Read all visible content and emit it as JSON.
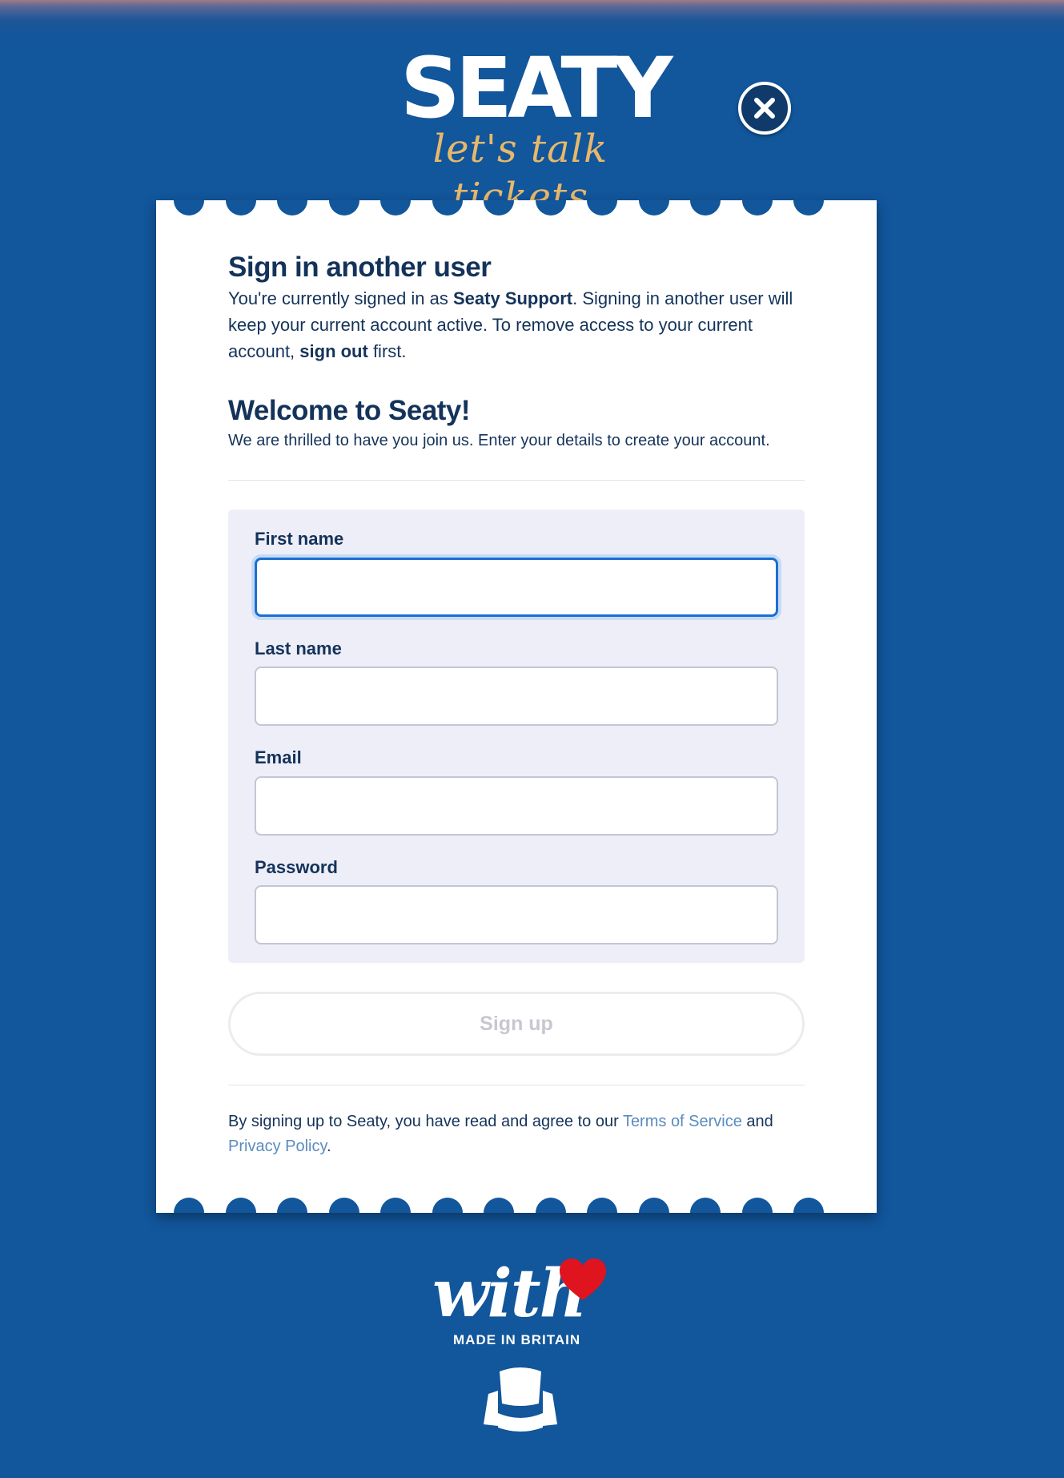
{
  "brand": {
    "name": "SEATY",
    "tagline": "let's talk tickets"
  },
  "intro": {
    "title": "Sign in another user",
    "text_before": "You're currently signed in as ",
    "user_name": "Seaty Support",
    "text_middle": ". Signing in another user will keep your current account active. To remove access to your current account, ",
    "sign_out_label": "sign out",
    "text_after": " first."
  },
  "welcome": {
    "title": "Welcome to Seaty!",
    "subtitle": "We are thrilled to have you join us. Enter your details to create your account."
  },
  "form": {
    "first_name_label": "First name",
    "first_name_value": "",
    "last_name_label": "Last name",
    "last_name_value": "",
    "email_label": "Email",
    "email_value": "",
    "password_label": "Password",
    "password_value": ""
  },
  "signup_label": "Sign up",
  "terms": {
    "text_before": "By signing up to Seaty, you have read and agree to our ",
    "terms_link": "Terms of Service",
    "text_and": " and ",
    "privacy_link": "Privacy Policy",
    "text_end": "."
  },
  "footer": {
    "with_text": "with",
    "made_text": "MADE IN BRITAIN"
  },
  "colors": {
    "background": "#12569b",
    "heading": "#14335a",
    "accent_gold": "#e7b86b",
    "link": "#5a8cbe",
    "heart": "#e0141e"
  },
  "icons": {
    "close": "close-icon",
    "heart": "heart-icon",
    "seat": "seat-icon"
  }
}
